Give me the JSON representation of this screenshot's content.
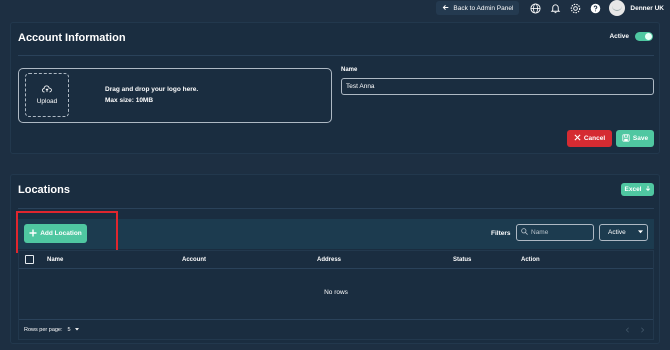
{
  "topbar": {
    "back_label": "Back to Admin Panel",
    "user_name": "Denner UK"
  },
  "account": {
    "title": "Account Information",
    "status_label": "Active",
    "upload_label": "Upload",
    "drop_text": "Drag and drop your logo here.",
    "max_size": "Max size: 10MB",
    "name_label": "Name",
    "name_value": "Test Anna",
    "cancel_label": "Cancel",
    "save_label": "Save"
  },
  "locations": {
    "title": "Locations",
    "excel_label": "Excel",
    "add_label": "Add Location",
    "filters_label": "Filters",
    "name_placeholder": "Name",
    "status_filter": "Active",
    "columns": [
      "Name",
      "Account",
      "Address",
      "Status",
      "Action"
    ],
    "empty_text": "No rows",
    "rows_per_page_label": "Rows per page:",
    "rows_per_page_value": "5"
  },
  "colors": {
    "accent": "#4fc7a1",
    "danger": "#d52b32",
    "highlight": "#e0262e",
    "background": "#1d2f42"
  }
}
